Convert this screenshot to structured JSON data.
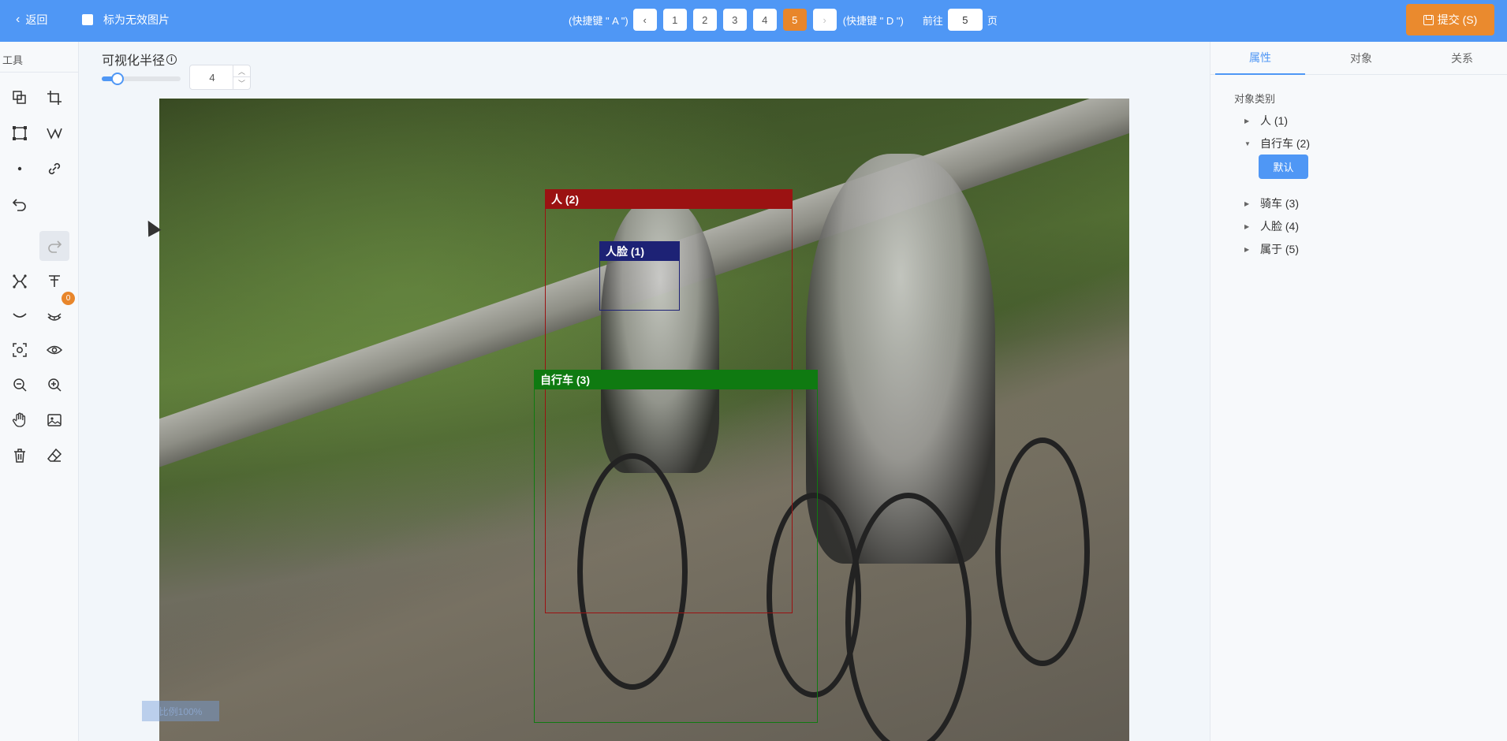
{
  "topbar": {
    "back_label": "返回",
    "invalid_label": "标为无效图片",
    "hint_prev": "(快捷键 \" A \")",
    "hint_next": "(快捷键 \" D \")",
    "pages": [
      "1",
      "2",
      "3",
      "4",
      "5"
    ],
    "current_page": "5",
    "goto_label": "前往",
    "goto_value": "5",
    "page_suffix": "页",
    "submit_label": "提交 (S)"
  },
  "toolbar": {
    "title": "工具",
    "badge_count": "0",
    "tools": [
      "copy-shape",
      "crop",
      "rectangle",
      "polyline",
      "point",
      "link",
      "undo",
      "redo",
      "keypoints",
      "text",
      "curve",
      "eyelash",
      "focus",
      "visibility",
      "zoom-out",
      "zoom-in",
      "pan",
      "image",
      "delete",
      "eraser"
    ]
  },
  "canvas": {
    "radius_label": "可视化半径",
    "radius_value": "4",
    "radius_fraction": 0.2,
    "zoom_label": "比例100%",
    "annotations": [
      {
        "label": "人 (2)",
        "color": "#9b1212"
      },
      {
        "label": "人脸 (1)",
        "color": "#1d2275"
      },
      {
        "label": "自行车 (3)",
        "color": "#0f7a11"
      }
    ]
  },
  "panel": {
    "tabs": [
      "属性",
      "对象",
      "关系"
    ],
    "active_tab": "属性",
    "section_title": "对象类别",
    "categories": [
      {
        "label": "人 (1)",
        "expanded": false
      },
      {
        "label": "自行车 (2)",
        "expanded": true
      },
      {
        "label": "骑车 (3)",
        "expanded": false
      },
      {
        "label": "人脸 (4)",
        "expanded": false
      },
      {
        "label": "属于 (5)",
        "expanded": false
      }
    ],
    "default_button": "默认"
  },
  "colors": {
    "primary": "#4f97f5",
    "accent": "#e8862b"
  }
}
